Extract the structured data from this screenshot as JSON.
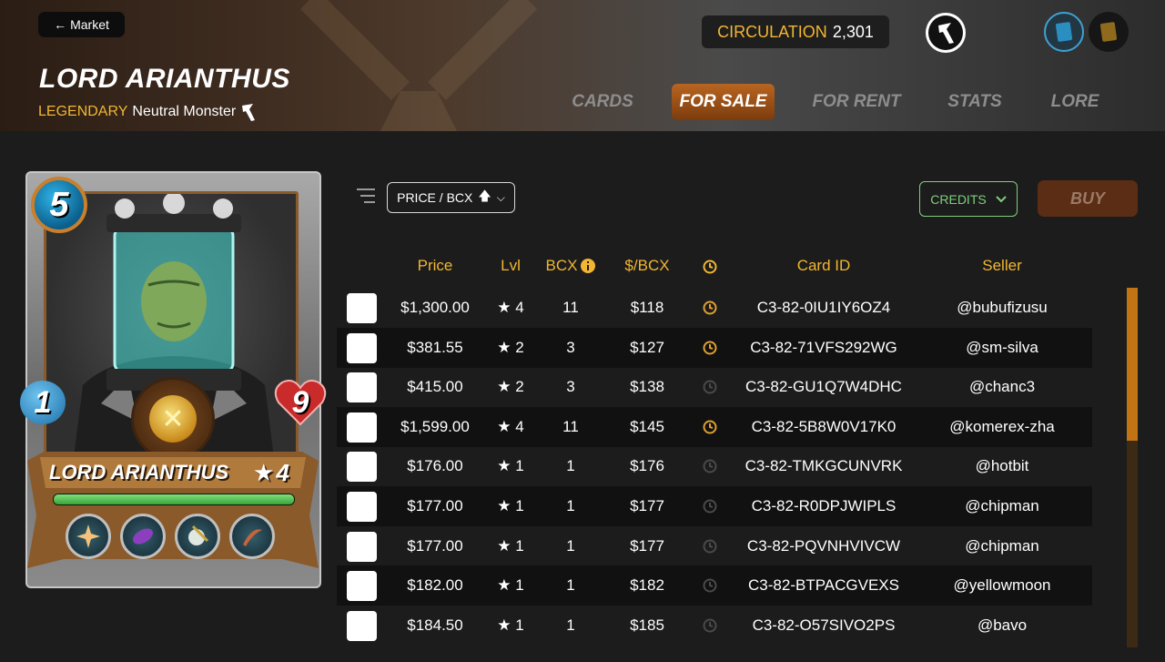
{
  "header": {
    "market_label": "Market",
    "monster_name": "LORD ARIANTHUS",
    "rarity": "LEGENDARY",
    "subtitle": "Neutral Monster",
    "circulation_label": "CIRCULATION",
    "circulation_value": "2,301"
  },
  "tabs": [
    {
      "label": "CARDS"
    },
    {
      "label": "FOR SALE"
    },
    {
      "label": "FOR RENT"
    },
    {
      "label": "STATS"
    },
    {
      "label": "LORE"
    }
  ],
  "card": {
    "mana": "5",
    "speed": "1",
    "health": "9",
    "name": "LORD ARIANTHUS",
    "level": "4",
    "xp_fraction": 1.0,
    "abilities": [
      "shatter-icon",
      "void-icon",
      "shield-icon",
      "sword-icon"
    ]
  },
  "controls": {
    "sort_value": "PRICE / BCX",
    "currency_value": "CREDITS",
    "buy_label": "BUY"
  },
  "table": {
    "headers": {
      "price": "Price",
      "lvl": "Lvl",
      "bcx": "BCX",
      "per_bcx": "$/BCX",
      "card_id": "Card ID",
      "seller": "Seller"
    },
    "rows": [
      {
        "price": "$1,300.00",
        "lvl": "4",
        "bcx": "11",
        "per_bcx": "$118",
        "card_id": "C3-82-0IU1IY6OZ4",
        "seller": "@bubufizusu",
        "timer_active": true
      },
      {
        "price": "$381.55",
        "lvl": "2",
        "bcx": "3",
        "per_bcx": "$127",
        "card_id": "C3-82-71VFS292WG",
        "seller": "@sm-silva",
        "timer_active": true
      },
      {
        "price": "$415.00",
        "lvl": "2",
        "bcx": "3",
        "per_bcx": "$138",
        "card_id": "C3-82-GU1Q7W4DHC",
        "seller": "@chanc3",
        "timer_active": false
      },
      {
        "price": "$1,599.00",
        "lvl": "4",
        "bcx": "11",
        "per_bcx": "$145",
        "card_id": "C3-82-5B8W0V17K0",
        "seller": "@komerex-zha",
        "timer_active": true
      },
      {
        "price": "$176.00",
        "lvl": "1",
        "bcx": "1",
        "per_bcx": "$176",
        "card_id": "C3-82-TMKGCUNVRK",
        "seller": "@hotbit",
        "timer_active": false
      },
      {
        "price": "$177.00",
        "lvl": "1",
        "bcx": "1",
        "per_bcx": "$177",
        "card_id": "C3-82-R0DPJWIPLS",
        "seller": "@chipman",
        "timer_active": false
      },
      {
        "price": "$177.00",
        "lvl": "1",
        "bcx": "1",
        "per_bcx": "$177",
        "card_id": "C3-82-PQVNHVIVCW",
        "seller": "@chipman",
        "timer_active": false
      },
      {
        "price": "$182.00",
        "lvl": "1",
        "bcx": "1",
        "per_bcx": "$182",
        "card_id": "C3-82-BTPACGVEXS",
        "seller": "@yellowmoon",
        "timer_active": false
      },
      {
        "price": "$184.50",
        "lvl": "1",
        "bcx": "1",
        "per_bcx": "$185",
        "card_id": "C3-82-O57SIVO2PS",
        "seller": "@bavo",
        "timer_active": false
      }
    ]
  },
  "colors": {
    "accent": "#f2b632",
    "tab_active": "#b86520",
    "currency": "#7ecf7e",
    "timer_active": "#e0a030",
    "timer_idle": "#4a4a4a"
  }
}
